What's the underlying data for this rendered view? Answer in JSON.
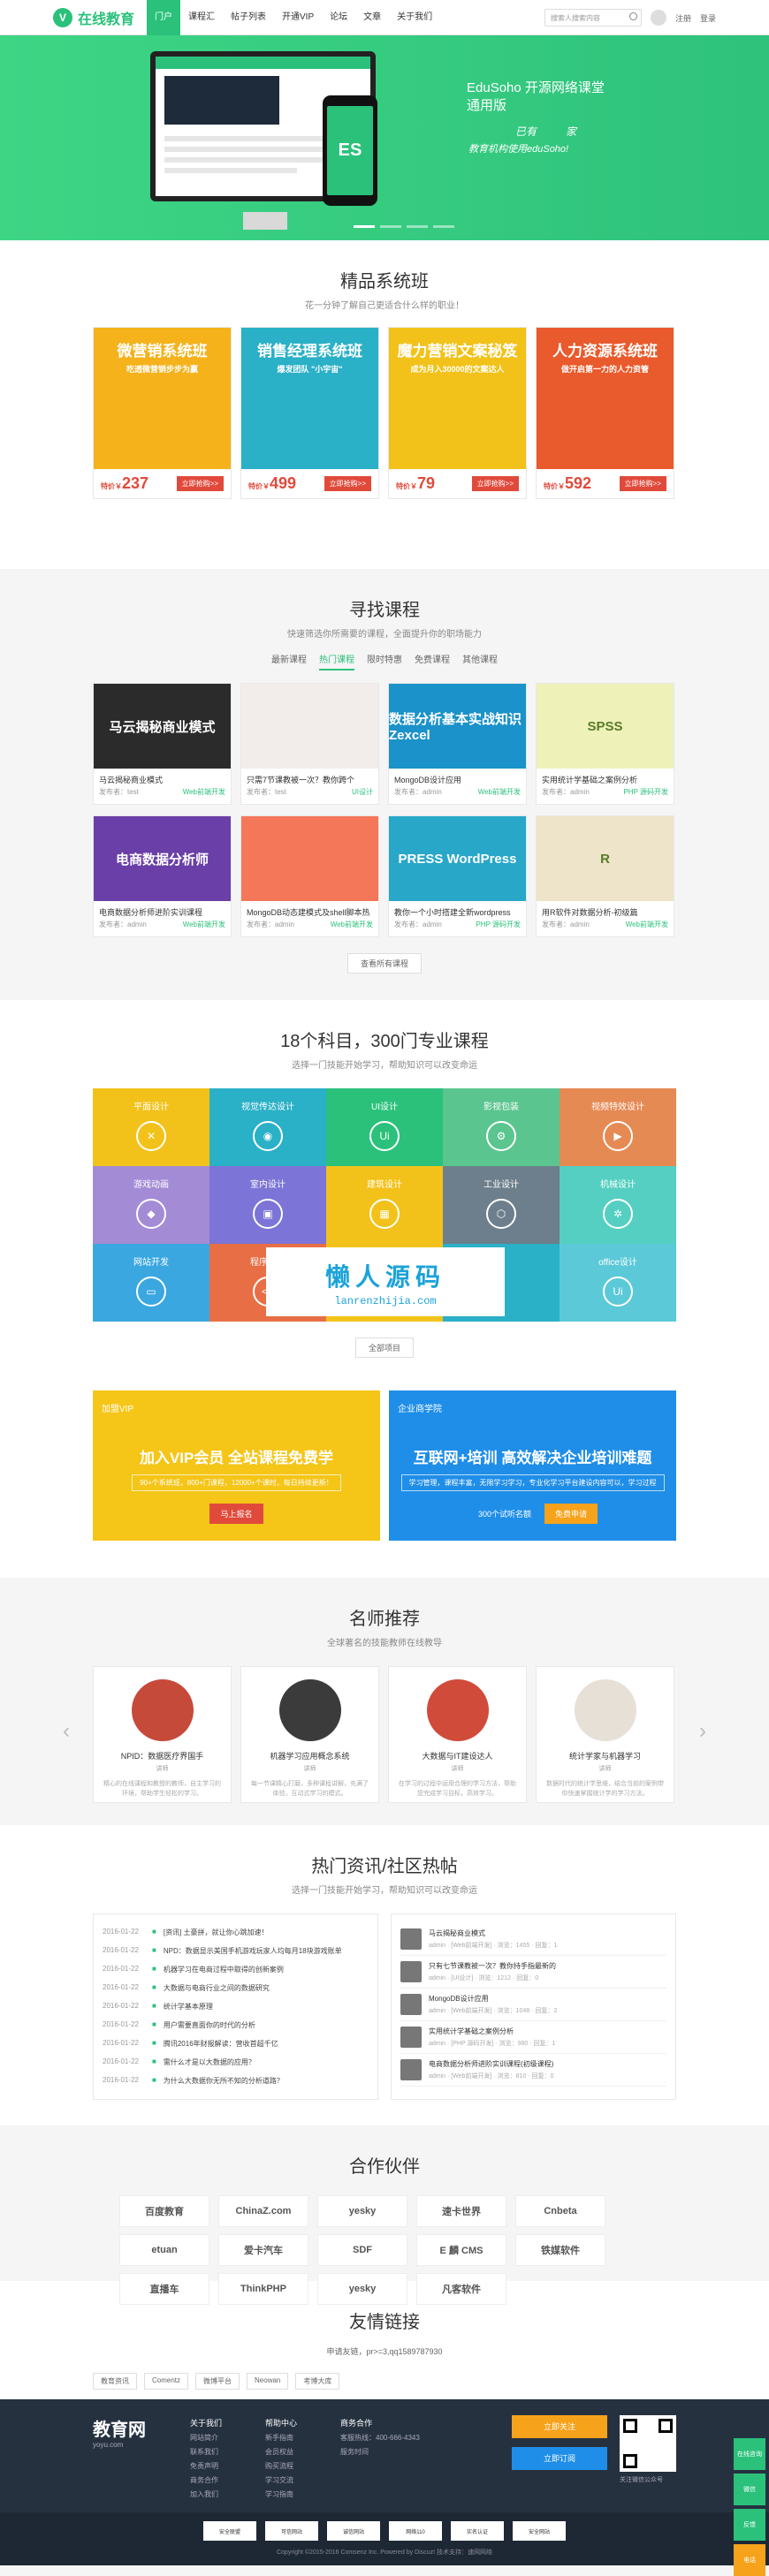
{
  "header": {
    "logo_text": "在线教育",
    "nav": [
      "门户",
      "课程汇",
      "帖子列表",
      "开通VIP",
      "论坛",
      "文章",
      "关于我们"
    ],
    "search_placeholder": "搜索人搜索内容",
    "login": "注册",
    "register": "登录"
  },
  "banner": {
    "title_1": "EduSoho 开源网络课堂",
    "title_2": "通用版",
    "slogan_1": "已有",
    "slogan_2": "家",
    "slogan_3": "教育机构使用eduSoho!",
    "phone_text": "ES"
  },
  "featured": {
    "title": "精品系统班",
    "subtitle": "花一分钟了解自己更适合什么样的职业！",
    "cards": [
      {
        "title": "微营销系统班",
        "sub": "吃透微营销步步为赢",
        "price": "237",
        "btn": "立即抢购>>",
        "color": "#f5b21b"
      },
      {
        "title": "销售经理系统班",
        "sub": "爆发团队 \"小宇宙\"",
        "price": "499",
        "btn": "立即抢购>>",
        "color": "#2ab0c7"
      },
      {
        "title": "魔力营销文案秘笈",
        "sub": "成为月入30000的文案达人",
        "price": "79",
        "btn": "立即抢购>>",
        "color": "#f2c21a"
      },
      {
        "title": "人力资源系统班",
        "sub": "做开启第一力的人力资管",
        "price": "592",
        "btn": "立即抢购>>",
        "color": "#e95a2c"
      }
    ],
    "price_label": "特价￥"
  },
  "find": {
    "title": "寻找课程",
    "subtitle": "快速筛选你所需要的课程，全面提升你的职场能力",
    "tabs": [
      "最新课程",
      "热门课程",
      "限时特惠",
      "免费课程",
      "其他课程"
    ],
    "courses": [
      {
        "img": "马云揭秘商业模式",
        "title": "马云揭秘商业模式",
        "author": "发布者：test",
        "tag": "Web前端开发",
        "color": "#2b2b2b"
      },
      {
        "img": "",
        "title": "只需7节课教被一次？教你跨个",
        "author": "发布者：test",
        "tag": "UI设计",
        "color": "#f2ecea"
      },
      {
        "img": "数据分析基本实战知识 Zexcel",
        "title": "MongoDB设计应用",
        "author": "发布者：admin",
        "tag": "Web前端开发",
        "color": "#1b92c9"
      },
      {
        "img": "SPSS",
        "title": "实用统计学基础之案例分析",
        "author": "发布者：admin",
        "tag": "PHP 源码开发",
        "color": "#eef2b8"
      },
      {
        "img": "电商数据分析师",
        "title": "电商数据分析师进阶实训课程",
        "author": "发布者：admin",
        "tag": "Web前端开发",
        "color": "#6a3fa7"
      },
      {
        "img": "",
        "title": "MongoDB动态建模式及shell脚本热",
        "author": "发布者：admin",
        "tag": "Web前端开发",
        "color": "#f4775a"
      },
      {
        "img": "PRESS WordPress",
        "title": "教你一个小时搭建全新wordpress",
        "author": "发布者：admin",
        "tag": "PHP 源码开发",
        "color": "#28a7c9"
      },
      {
        "img": "R",
        "title": "用R软件对数据分析-初级篇",
        "author": "发布者：admin",
        "tag": "Web前端开发",
        "color": "#eee4c9"
      }
    ],
    "more_btn": "查看所有课程"
  },
  "subjects": {
    "title": "18个科目，300门专业课程",
    "subtitle": "选择一门技能开始学习，帮助知识可以改变命运",
    "tiles": [
      {
        "label": "平面设计",
        "icon": "✕",
        "color": "#f2c21a"
      },
      {
        "label": "视觉传达设计",
        "icon": "◉",
        "color": "#2ab0c7"
      },
      {
        "label": "UI设计",
        "icon": "Ui",
        "color": "#2bc17b"
      },
      {
        "label": "影视包装",
        "icon": "⚙",
        "color": "#5bc58f"
      },
      {
        "label": "视频特效设计",
        "icon": "▶",
        "color": "#e68a54"
      },
      {
        "label": "游戏动画",
        "icon": "◆",
        "color": "#a48bd6"
      },
      {
        "label": "室内设计",
        "icon": "▣",
        "color": "#7c74d6"
      },
      {
        "label": "建筑设计",
        "icon": "▦",
        "color": "#f2c21a"
      },
      {
        "label": "工业设计",
        "icon": "⬡",
        "color": "#6d7f8c"
      },
      {
        "label": "机械设计",
        "icon": "✲",
        "color": "#55cfc1"
      },
      {
        "label": "网站开发",
        "icon": "▭",
        "color": "#3aa7e0"
      },
      {
        "label": "程序开发",
        "icon": "<>",
        "color": "#e86f45"
      },
      {
        "label": "",
        "icon": "",
        "color": "#f2c21a"
      },
      {
        "label": "",
        "icon": "",
        "color": "#2ab0c7"
      },
      {
        "label": "office设计",
        "icon": "Ui",
        "color": "#5bc9d8"
      }
    ],
    "overlay_1": "懒人源码",
    "overlay_2": "lanrenzhijia.com",
    "more_btn": "全部项目"
  },
  "promo": {
    "vip_tag": "加盟VIP",
    "vip_title": "加入VIP会员   全站课程免费学",
    "vip_desc": "90+个系统班，800+门课程，12000+个课时，每日持续更新！",
    "vip_btn": "马上报名",
    "ent_tag": "企业商学院",
    "ent_title": "互联网+培训 高效解决企业培训难题",
    "ent_desc": "学习管理，课程丰富，无限学习学习，专业化学习平台建设内容可以，学习过程",
    "ent_btn_1": "300个试听名额",
    "ent_btn_2": "免费申请"
  },
  "teachers": {
    "title": "名师推荐",
    "subtitle": "全球著名的技能教师在线教导",
    "items": [
      {
        "name": "NPID：数据医疗界国手",
        "role": "讲师",
        "desc": "精心的在线课程和教授的教师，自主学习的环境，帮助学生轻松的学习。"
      },
      {
        "name": "机器学习应用概念系统",
        "role": "讲师",
        "desc": "每一节课精心打磨，多种课程讲解，充满了体验，互动式学习的模式。"
      },
      {
        "name": "大数据与IT建设达人",
        "role": "讲师",
        "desc": "在学习的过程中运用合理的学习方法，帮助您完成学习目标，高效学习。"
      },
      {
        "name": "统计学家与机器学习",
        "role": "讲师",
        "desc": "数据时代的统计学思维，结合当前的案例带你快速掌握统计学的学习方法。"
      }
    ]
  },
  "news": {
    "title": "热门资讯/社区热帖",
    "subtitle": "选择一门技能开始学习，帮助知识可以改变命运",
    "items": [
      {
        "date": "2016-01-22",
        "text": "[资讯] 土豪拼，就让你心跳加速！"
      },
      {
        "date": "2016-01-22",
        "text": "NPD：数据显示美国手机游戏玩家人均每月18块游戏账单"
      },
      {
        "date": "2016-01-22",
        "text": "机器学习在电商过程中取得的创新案例"
      },
      {
        "date": "2016-01-22",
        "text": "大数据与电商行业之间的数据研究"
      },
      {
        "date": "2016-01-22",
        "text": "统计学基本原理"
      },
      {
        "date": "2016-01-22",
        "text": "用户需要直面你的时代的分析"
      },
      {
        "date": "2016-01-22",
        "text": "腾讯2016年财报解读：营收首超千亿"
      },
      {
        "date": "2016-01-22",
        "text": "需什么才是以大数据的应用？"
      },
      {
        "date": "2016-01-22",
        "text": "为什么大数据你无所不知的分析道路？"
      }
    ],
    "posts": [
      {
        "title": "马云揭秘商业模式",
        "meta": "admin · [Web前端开发] · 浏览：1455 · 回复：1"
      },
      {
        "title": "只有七节课教被一次？教你持手指最新的",
        "meta": "admin · [UI设计] · 浏览：1212 · 回复：0"
      },
      {
        "title": "MongoDB设计应用",
        "meta": "admin · [Web前端开发] · 浏览：1048 · 回复：2"
      },
      {
        "title": "实用统计学基础之案例分析",
        "meta": "admin · [PHP 源码开发] · 浏览：980 · 回复：1"
      },
      {
        "title": "电商数据分析师进阶实训课程(初级课程)",
        "meta": "admin · [Web前端开发] · 浏览：810 · 回复：0"
      }
    ]
  },
  "partners": {
    "title": "合作伙伴",
    "items": [
      "百度教育",
      "ChinaZ.com",
      "yesky",
      "速卡世界",
      "Cnbeta",
      "etuan",
      "爱卡汽车",
      "SDF",
      "E 麟 CMS",
      "铁媒软件",
      "直播车",
      "ThinkPHP",
      "yesky",
      "凡客软件"
    ]
  },
  "links": {
    "title": "友情链接",
    "apply": "申请友链，pr>=3,qq1589787930",
    "items": [
      "教育资讯",
      "Comentz",
      "微博平台",
      "Neowan",
      "考博大库"
    ]
  },
  "footer": {
    "logo": "教育网",
    "logo_sub": "yoyu.com",
    "col1": {
      "title": "关于我们",
      "items": [
        "网站简介",
        "联系我们",
        "免责声明",
        "商务合作",
        "加入我们"
      ]
    },
    "col2": {
      "title": "帮助中心",
      "items": [
        "新手指南",
        "会员权益",
        "购买流程",
        "学习交流",
        "学习指南"
      ]
    },
    "col3": {
      "title": "商务合作",
      "items": [
        "客服热线：400-666-4343",
        "服务时间"
      ]
    },
    "btn_weibo": "立即关注",
    "btn_mail": "立即订阅",
    "qr_caption": "关注微信公众号",
    "badges": [
      "安全联盟",
      "可信网站",
      "诚信网站",
      "网络110",
      "实名认证",
      "安全网站"
    ],
    "copyright": "Copyright ©2015-2016 Comsenz Inc. Powered by Discuz! 技术支持：速网网络"
  },
  "sidebar": {
    "items": [
      "在线咨询",
      "微信",
      "反馈",
      "电话"
    ]
  }
}
